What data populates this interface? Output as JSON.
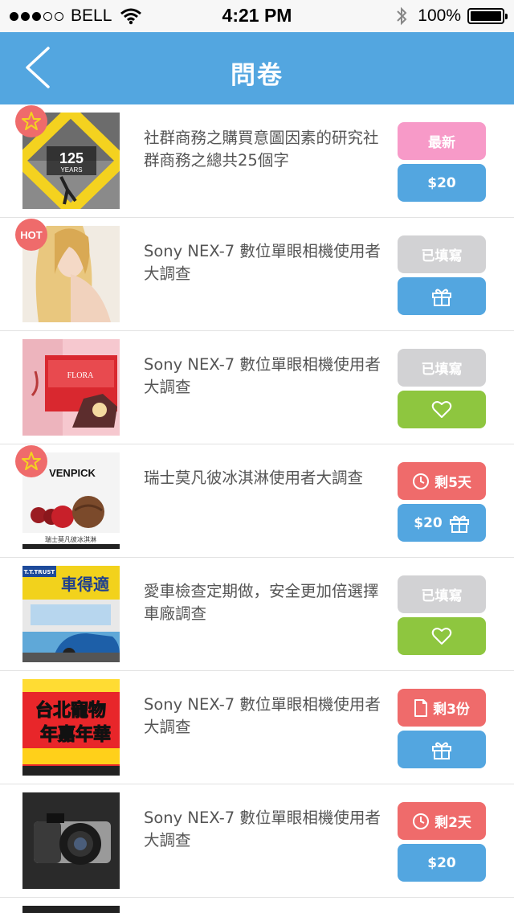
{
  "status_bar": {
    "carrier": "BELL",
    "time": "4:21 PM",
    "battery": "100%"
  },
  "nav": {
    "title": "問卷"
  },
  "items": [
    {
      "title": "社群商務之購買意圖因素的研究社群商務之總共25個字",
      "badge": "star",
      "thumb_text": "125",
      "thumb_subtext": "YEARS",
      "top_button": {
        "label": "最新",
        "color": "#f79ac8"
      },
      "bottom_button": {
        "label": "$20",
        "color": "#53a6e0"
      }
    },
    {
      "title": "Sony NEX-7 數位單眼相機使用者大調查",
      "badge": "HOT",
      "top_button": {
        "label": "已填寫",
        "color": "#d2d2d4"
      },
      "bottom_button": {
        "icon": "gift-icon",
        "color": "#53a6e0"
      }
    },
    {
      "title": "Sony NEX-7 數位單眼相機使用者大調查",
      "badge": null,
      "thumb_text": "FLORA",
      "top_button": {
        "label": "已填寫",
        "color": "#d2d2d4"
      },
      "bottom_button": {
        "icon": "heart-icon",
        "color": "#8ec63f"
      }
    },
    {
      "title": "瑞士莫凡彼冰淇淋使用者大調查",
      "badge": "star",
      "thumb_text": "VENPICK",
      "thumb_subtext": "瑞士莫凡彼冰淇淋",
      "top_button": {
        "label": "剩5天",
        "icon": "clock-icon",
        "color": "#ef6b6b"
      },
      "bottom_button": {
        "label": "$20",
        "icon": "gift-icon",
        "color": "#53a6e0"
      }
    },
    {
      "title": "愛車檢查定期做，安全更加倍選擇車廠調查",
      "badge": null,
      "thumb_text": "車得適",
      "thumb_subtext": "T.T.TRUST",
      "top_button": {
        "label": "已填寫",
        "color": "#d2d2d4"
      },
      "bottom_button": {
        "icon": "heart-icon",
        "color": "#8ec63f"
      }
    },
    {
      "title": "Sony NEX-7 數位單眼相機使用者大調查",
      "badge": null,
      "thumb_text": "台北寵物",
      "thumb_subtext": "年嘉年華",
      "top_button": {
        "label": "剩3份",
        "icon": "document-icon",
        "color": "#ef6b6b"
      },
      "bottom_button": {
        "icon": "gift-icon",
        "color": "#53a6e0"
      }
    },
    {
      "title": "Sony NEX-7 數位單眼相機使用者大調查",
      "badge": null,
      "top_button": {
        "label": "剩2天",
        "icon": "clock-icon",
        "color": "#ef6b6b"
      },
      "bottom_button": {
        "label": "$20",
        "color": "#53a6e0"
      }
    }
  ]
}
